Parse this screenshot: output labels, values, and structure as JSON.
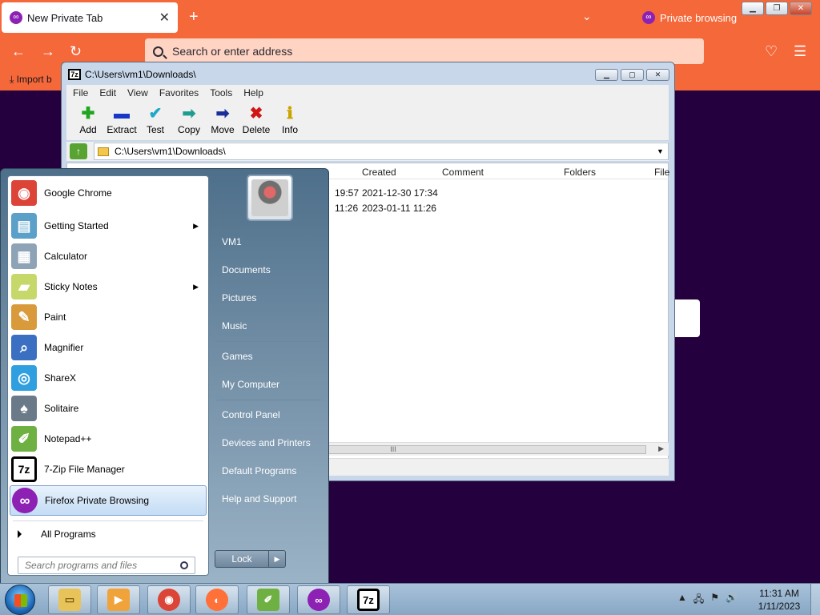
{
  "firefox": {
    "tab_title": "New Private Tab",
    "tab_close": "✕",
    "new_tab": "+",
    "tabs_list": "⌄",
    "private_label": "Private browsing",
    "caption": {
      "minimize": "▁",
      "restore": "❐",
      "close": "✕"
    },
    "nav": {
      "back": "←",
      "forward": "→",
      "reload": "↻",
      "pocket": "♡",
      "menu": "☰"
    },
    "urlbar_placeholder": "Search or enter address",
    "bookmarks_import": "⤓ Import b"
  },
  "zip": {
    "title": "C:\\Users\\vm1\\Downloads\\",
    "logo": "7z",
    "caption": {
      "minimize": "▁",
      "maximize": "▢",
      "close": "✕"
    },
    "menu": [
      "File",
      "Edit",
      "View",
      "Favorites",
      "Tools",
      "Help"
    ],
    "toolbar": [
      {
        "label": "Add",
        "icon": "✚",
        "color": "#1fa51f"
      },
      {
        "label": "Extract",
        "icon": "▬",
        "color": "#1638c5"
      },
      {
        "label": "Test",
        "icon": "✔",
        "color": "#1fa8c9"
      },
      {
        "label": "Copy",
        "icon": "➡",
        "color": "#1e9c8f"
      },
      {
        "label": "Move",
        "icon": "➡",
        "color": "#1a2f9a"
      },
      {
        "label": "Delete",
        "icon": "✖",
        "color": "#d11414"
      },
      {
        "label": "Info",
        "icon": "ℹ",
        "color": "#c9a400"
      }
    ],
    "address": "C:\\Users\\vm1\\Downloads\\",
    "address_dropdown": "▼",
    "up_icon": "↑",
    "columns": {
      "created": "Created",
      "comment": "Comment",
      "folders": "Folders",
      "files": "File"
    },
    "rows": [
      {
        "modified": "19:57",
        "created": "2021-12-30 17:34"
      },
      {
        "modified": "11:26",
        "created": "2023-01-11 11:26"
      }
    ],
    "hscroll_grip": "III",
    "hscroll_right": "▶"
  },
  "startmenu": {
    "programs": [
      {
        "label": "Google Chrome",
        "icon": "chrome-icon",
        "glyph": "◉",
        "bg": "#db4437",
        "arrow": false
      },
      {
        "label": "Getting Started",
        "icon": "getting-started-icon",
        "glyph": "▤",
        "bg": "#5aa0c8",
        "arrow": true
      },
      {
        "label": "Calculator",
        "icon": "calculator-icon",
        "glyph": "▦",
        "bg": "#8fa3b6",
        "arrow": false
      },
      {
        "label": "Sticky Notes",
        "icon": "sticky-notes-icon",
        "glyph": "▰",
        "bg": "#c7d86a",
        "arrow": true
      },
      {
        "label": "Paint",
        "icon": "paint-icon",
        "glyph": "✎",
        "bg": "#d99a3c",
        "arrow": false
      },
      {
        "label": "Magnifier",
        "icon": "magnifier-icon",
        "glyph": "⌕",
        "bg": "#3a6fc2",
        "arrow": false
      },
      {
        "label": "ShareX",
        "icon": "sharex-icon",
        "glyph": "◎",
        "bg": "#2f9fe0",
        "arrow": false
      },
      {
        "label": "Solitaire",
        "icon": "solitaire-icon",
        "glyph": "♠",
        "bg": "#6b7a88",
        "arrow": false
      },
      {
        "label": "Notepad++",
        "icon": "notepadpp-icon",
        "glyph": "✐",
        "bg": "#6fb043",
        "arrow": false
      },
      {
        "label": "7-Zip File Manager",
        "icon": "sevenzip-icon",
        "glyph": "7z",
        "bg": "#ffffff",
        "arrow": false
      },
      {
        "label": "Firefox Private Browsing",
        "icon": "firefox-private-icon",
        "glyph": "∞",
        "bg": "#8c21b4",
        "arrow": false
      }
    ],
    "arrow_glyph": "▶",
    "all_programs": "All Programs",
    "search_placeholder": "Search programs and files",
    "right": [
      "VM1",
      "Documents",
      "Pictures",
      "Music",
      "Games",
      "My Computer",
      "Control Panel",
      "Devices and Printers",
      "Default Programs",
      "Help and Support"
    ],
    "lock": "Lock",
    "lock_more": "▶"
  },
  "taskbar": {
    "items": [
      {
        "name": "explorer",
        "glyph": "▭",
        "bg": "#e8c35a",
        "fg": "#7a5a10"
      },
      {
        "name": "media-player",
        "glyph": "▶",
        "bg": "#f0a33a",
        "fg": "#fff"
      },
      {
        "name": "chrome",
        "glyph": "◉",
        "bg": "#db4437",
        "fg": "#fff"
      },
      {
        "name": "firefox",
        "glyph": "◐",
        "bg": "#ff7139",
        "fg": "#fff"
      },
      {
        "name": "notepadpp",
        "glyph": "✐",
        "bg": "#6fb043",
        "fg": "#fff"
      },
      {
        "name": "firefox-private",
        "glyph": "∞",
        "bg": "#8c21b4",
        "fg": "#fff"
      },
      {
        "name": "sevenzip",
        "glyph": "7z",
        "bg": "#ffffff",
        "fg": "#000"
      }
    ],
    "tray": [
      "▲",
      "🖧",
      "⚑",
      "🔊"
    ],
    "time": "11:31 AM",
    "date": "1/11/2023"
  }
}
